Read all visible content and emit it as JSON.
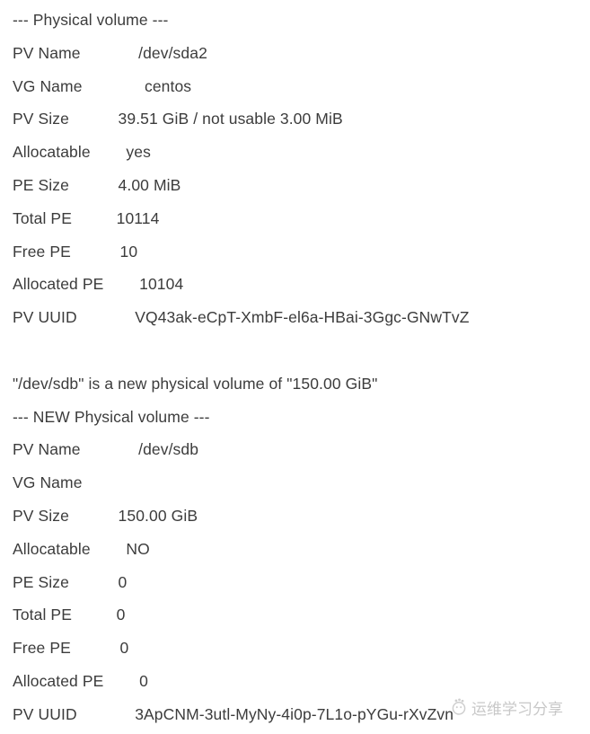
{
  "document": {
    "type": "terminal-output",
    "command_context": "pvdisplay",
    "text_color": "#3c3c3c",
    "background_color": "#ffffff",
    "lines": [
      {
        "kind": "header",
        "text": "--- Physical volume ---"
      },
      {
        "kind": "field",
        "label": "PV Name",
        "pad": "             ",
        "value": "/dev/sda2"
      },
      {
        "kind": "field",
        "label": "VG Name",
        "pad": "              ",
        "value": "centos"
      },
      {
        "kind": "field",
        "label": "PV Size",
        "pad": "           ",
        "value": "39.51 GiB / not usable 3.00 MiB"
      },
      {
        "kind": "field",
        "label": "Allocatable",
        "pad": "        ",
        "value": "yes"
      },
      {
        "kind": "field",
        "label": "PE Size",
        "pad": "           ",
        "value": "4.00 MiB"
      },
      {
        "kind": "field",
        "label": "Total PE",
        "pad": "          ",
        "value": "10114"
      },
      {
        "kind": "field",
        "label": "Free PE",
        "pad": "           ",
        "value": "10"
      },
      {
        "kind": "field",
        "label": "Allocated PE",
        "pad": "        ",
        "value": "10104"
      },
      {
        "kind": "field",
        "label": "PV UUID",
        "pad": "             ",
        "value": "VQ43ak-eCpT-XmbF-el6a-HBai-3Ggc-GNwTvZ"
      },
      {
        "kind": "blank",
        "text": ""
      },
      {
        "kind": "message",
        "text": "\"/dev/sdb\" is a new physical volume of \"150.00 GiB\""
      },
      {
        "kind": "header",
        "text": "--- NEW Physical volume ---"
      },
      {
        "kind": "field",
        "label": "PV Name",
        "pad": "             ",
        "value": "/dev/sdb"
      },
      {
        "kind": "field",
        "label": "VG Name",
        "pad": "",
        "value": ""
      },
      {
        "kind": "field",
        "label": "PV Size",
        "pad": "           ",
        "value": "150.00 GiB"
      },
      {
        "kind": "field",
        "label": "Allocatable",
        "pad": "        ",
        "value": "NO"
      },
      {
        "kind": "field",
        "label": "PE Size",
        "pad": "           ",
        "value": "0"
      },
      {
        "kind": "field",
        "label": "Total PE",
        "pad": "          ",
        "value": "0"
      },
      {
        "kind": "field",
        "label": "Free PE",
        "pad": "           ",
        "value": "0"
      },
      {
        "kind": "field",
        "label": "Allocated PE",
        "pad": "        ",
        "value": "0"
      },
      {
        "kind": "field",
        "label": "PV UUID",
        "pad": "             ",
        "value": "3ApCNM-3utl-MyNy-4i0p-7L1o-pYGu-rXvZvn"
      }
    ]
  },
  "watermark": {
    "text": "运维学习分享",
    "color": "#7e7e7e"
  }
}
